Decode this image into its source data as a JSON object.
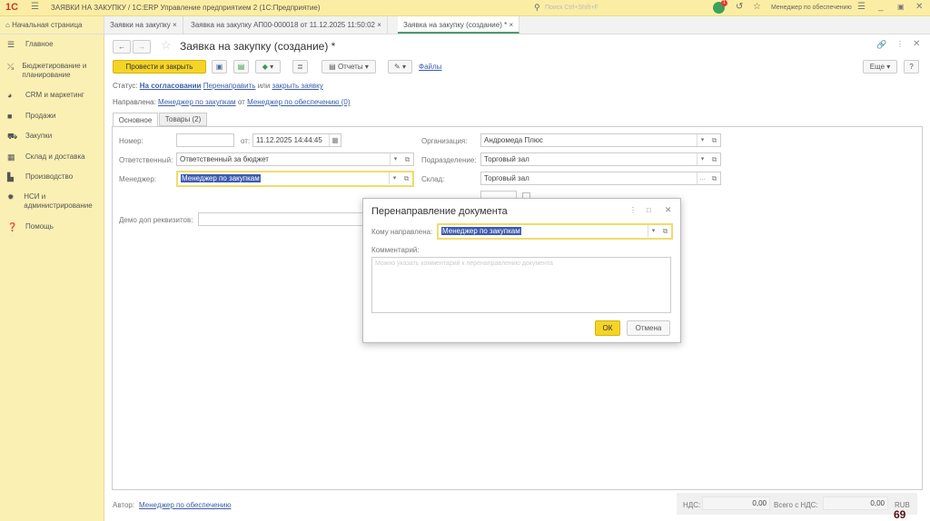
{
  "titlebar": {
    "title": "ЗАЯВКИ НА ЗАКУПКУ / 1С:ERP Управление предприятием 2  (1С:Предприятие)",
    "search_placeholder": "Поиск Ctrl+Shift+F",
    "user": "Менеджер по обеспечению",
    "notif_count": "1"
  },
  "tabs": [
    {
      "label": "Начальная страница"
    },
    {
      "label": "Заявки на закупку"
    },
    {
      "label": "Заявка на закупку АП00-000018 от 11.12.2025 11:50:02"
    },
    {
      "label": "Заявка на закупку (создание) *"
    }
  ],
  "sidebar": {
    "items": [
      {
        "label": "Главное",
        "icon": "menu-icon"
      },
      {
        "label": "Бюджетирование и планирование",
        "icon": "chart-icon"
      },
      {
        "label": "CRM и маркетинг",
        "icon": "pie-icon"
      },
      {
        "label": "Продажи",
        "icon": "bag-icon"
      },
      {
        "label": "Закупки",
        "icon": "cart-icon"
      },
      {
        "label": "Склад и доставка",
        "icon": "warehouse-icon"
      },
      {
        "label": "Производство",
        "icon": "factory-icon"
      },
      {
        "label": "НСИ и администрирование",
        "icon": "gear-icon"
      },
      {
        "label": "Помощь",
        "icon": "help-icon"
      }
    ]
  },
  "form": {
    "title": "Заявка на закупку (создание) *",
    "post_close": "Провести и закрыть",
    "reports": "Отчеты",
    "files": "Файлы",
    "more": "Еще",
    "help": "?",
    "status_label": "Статус:",
    "status_value": "На согласовании",
    "redirect": "Перенаправить",
    "or": "или",
    "close_request": "закрыть заявку",
    "directed_label": "Направлена:",
    "directed_to": "Менеджер по закупкам",
    "from": "от",
    "directed_from": "Менеджер по обеспечению (0)",
    "tab_main": "Основное",
    "tab_goods": "Товары (2)",
    "number_label": "Номер:",
    "number_value": "",
    "date_label": "от:",
    "date_value": "11.12.2025 14:44:45",
    "responsible_label": "Ответственный:",
    "responsible_value": "Ответственный за бюджет",
    "manager_label": "Менеджер:",
    "manager_value": "Менеджер по закупкам",
    "demo_label": "Демо доп реквизитов:",
    "demo_value": "",
    "org_label": "Организация:",
    "org_value": "Андромеда Плюс",
    "dept_label": "Подразделение:",
    "dept_value": "Торговый зал",
    "warehouse_label": "Склад:",
    "warehouse_value": "Торговый зал",
    "author_label": "Автор:",
    "author_value": "Менеджер по обеспечению",
    "vat_label": "НДС:",
    "vat_value": "0,00",
    "total_label": "Всего с НДС:",
    "total_value": "0,00",
    "currency": "RUB"
  },
  "dialog": {
    "title": "Перенаправление документа",
    "to_label": "Кому направлена:",
    "to_value": "Менеджер по закупкам",
    "comment_label": "Комментарий:",
    "comment_placeholder": "Можно указать комментарий к перенаправлению документа",
    "ok": "ОК",
    "cancel": "Отмена"
  },
  "page_number": "69"
}
